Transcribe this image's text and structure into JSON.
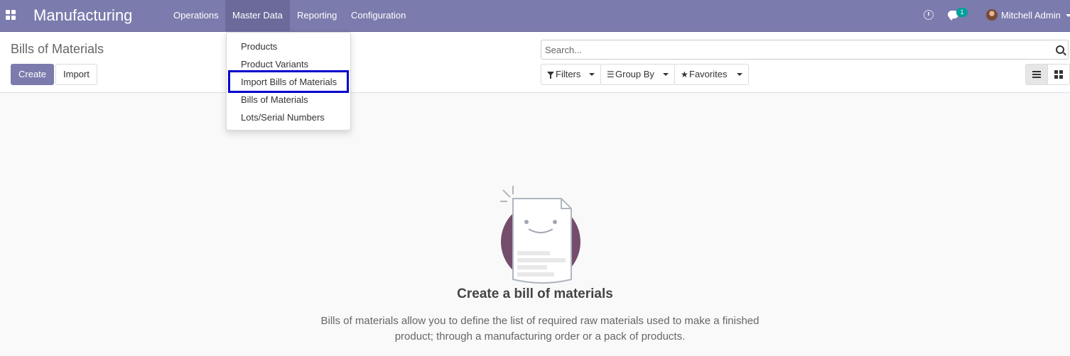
{
  "navbar": {
    "app_title": "Manufacturing",
    "menus": [
      "Operations",
      "Master Data",
      "Reporting",
      "Configuration"
    ],
    "active_menu": "Master Data",
    "chat_count": "1",
    "user_name": "Mitchell Admin",
    "bg_color": "#7c7bad",
    "icons": [
      "apps-grid-icon",
      "clock-icon",
      "chat-icon",
      "avatar"
    ]
  },
  "master_data_menu": {
    "items": [
      "Products",
      "Product Variants",
      "Import Bills of Materials",
      "Bills of Materials",
      "Lots/Serial Numbers"
    ],
    "highlighted": "Import Bills of Materials",
    "highlight_color": "#0000cc"
  },
  "control_panel": {
    "title": "Bills of Materials",
    "create_label": "Create",
    "import_label": "Import",
    "search_placeholder": "Search...",
    "filters_label": "Filters",
    "groupby_label": "Group By",
    "favorites_label": "Favorites",
    "active_view": "list",
    "accent_color": "#7c7bad"
  },
  "empty_state": {
    "title": "Create a bill of materials",
    "text": "Bills of materials allow you to define the list of required raw materials used to make a finished product; through a manufacturing order or a pack of products."
  }
}
